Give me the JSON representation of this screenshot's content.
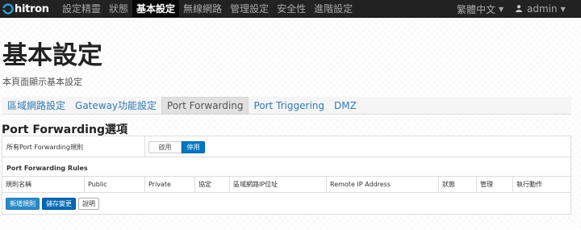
{
  "brand": {
    "logo_text": "hitron"
  },
  "nav": {
    "items": [
      "設定精靈",
      "狀態",
      "基本設定",
      "無線網路",
      "管理設定",
      "安全性",
      "進階設定"
    ],
    "active_index": 2,
    "language": "繁體中文",
    "user": "admin"
  },
  "page": {
    "title": "基本設定",
    "subtitle": "本頁面顯示基本設定"
  },
  "tabs": [
    "區域網路設定",
    "Gateway功能設定",
    "Port Forwarding",
    "Port Triggering",
    "DMZ"
  ],
  "active_tab": 2,
  "section": {
    "title": "Port Forwarding選項",
    "toggle_label": "所有Port Forwarding規則",
    "toggle_off": "啟用",
    "toggle_on": "停用",
    "rules_title": "Port Forwarding Rules",
    "columns": [
      "規則名稱",
      "Public",
      "Private",
      "協定",
      "區域網路IP位址",
      "Remote IP Address",
      "狀態",
      "管理",
      "執行動作"
    ]
  },
  "buttons": {
    "add": "新增規則",
    "save": "儲存變更",
    "help": "說明"
  },
  "colors": {
    "navbar": "#222222",
    "link": "#337ab7",
    "toggle_on": "#0077c0"
  }
}
